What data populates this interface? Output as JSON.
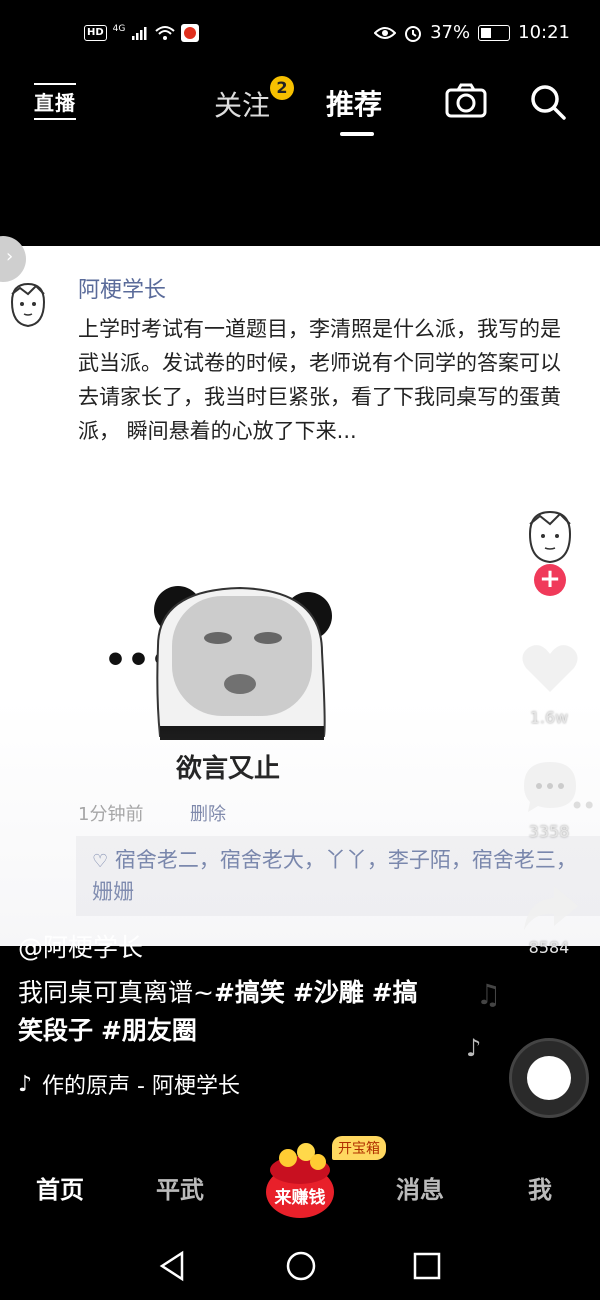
{
  "status_bar": {
    "network_hd": "HD",
    "network_gen": "4G",
    "battery_percent": "37%",
    "time": "10:21",
    "battery_level": 0.37
  },
  "top_nav": {
    "live_label": "直播",
    "follow_label": "关注",
    "follow_badge": "2",
    "recommend_label": "推荐"
  },
  "post": {
    "author": "阿梗学长",
    "text": "上学时考试有一道题目，李清照是什么派，我写的是武当派。发试卷的时候，老师说有个同学的答案可以去请家长了，我当时巨紧张，看了下我同桌写的蛋黄派， 瞬间悬着的心放了下来...",
    "meme_caption": "欲言又止",
    "meme_dots": "...",
    "timestamp": "1分钟前",
    "delete_label": "删除",
    "likes_text": "宿舍老二，宿舍老大，丫丫，李子陌，宿舍老三，姗姗"
  },
  "actions": {
    "like_count": "1.6w",
    "comment_count": "3358",
    "share_count": "8584"
  },
  "video": {
    "handle": "@阿梗学长",
    "caption_plain": "我同桌可真离谱~",
    "tags": [
      "#搞笑",
      "#沙雕",
      "#搞笑段子",
      "#朋友圈"
    ],
    "music": "作的原声 - 阿梗学长"
  },
  "bottom_nav": {
    "home": "首页",
    "pingwu": "平武",
    "earn": "来赚钱",
    "chest": "开宝箱",
    "messages": "消息",
    "me": "我"
  },
  "colors": {
    "accent_pink": "#f03a5a",
    "badge_yellow": "#f6c000",
    "author_blue": "#5a6b9a"
  },
  "icons": [
    "signal-icon",
    "wifi-icon",
    "eye-icon",
    "alarm-icon",
    "camera-icon",
    "search-icon",
    "heart-icon",
    "comment-icon",
    "share-icon",
    "music-note-icon",
    "back-icon",
    "home-icon",
    "recents-icon"
  ]
}
